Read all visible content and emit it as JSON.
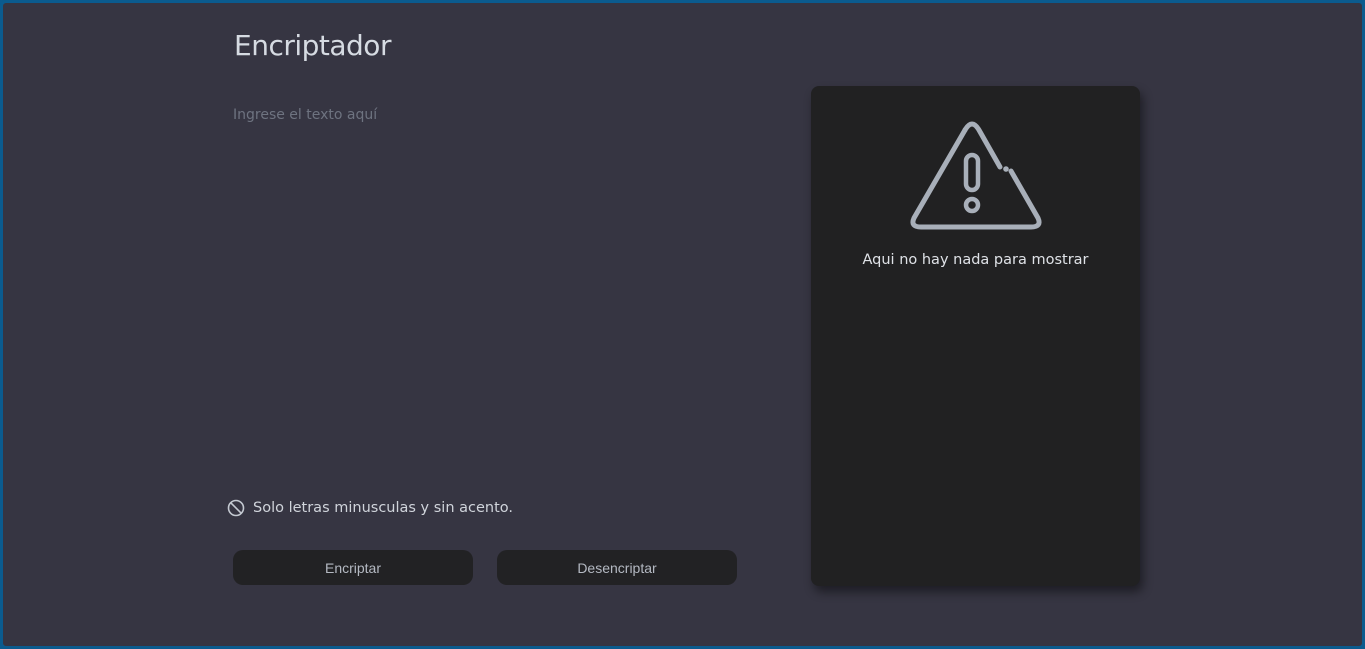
{
  "header": {
    "title": "Encriptador"
  },
  "input": {
    "placeholder": "Ingrese el texto aquí",
    "value": ""
  },
  "hint": {
    "icon": "prohibited-icon",
    "text": "Solo letras minusculas y sin acento."
  },
  "buttons": {
    "encrypt_label": "Encriptar",
    "decrypt_label": "Desencriptar"
  },
  "output": {
    "icon": "warning-icon",
    "empty_message": "Aqui no hay nada para mostrar"
  },
  "colors": {
    "background": "#363542",
    "frame_border": "#0b5b8e",
    "panel": "#212122",
    "button": "#222224",
    "icon": "#a8afb9"
  }
}
